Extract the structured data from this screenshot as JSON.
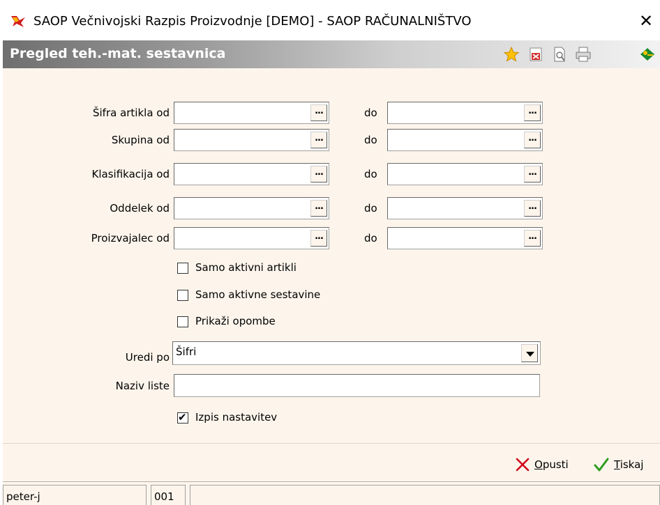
{
  "window": {
    "title": "SAOP   Večnivojski Razpis Proizvodnje [DEMO] - SAOP RAČUNALNIŠTVO",
    "close_symbol": "✕"
  },
  "header": {
    "title": "Pregled teh.-mat. sestavnica",
    "toolbar_icons": [
      "star-icon",
      "excel-export-icon",
      "print-preview-icon",
      "printer-icon",
      "exit-icon"
    ]
  },
  "form": {
    "range_to_label": "do",
    "ellipsis": "...",
    "range_rows": [
      {
        "label": "Šifra artikla od",
        "from_value": "",
        "to_value": ""
      },
      {
        "label": "Skupina od",
        "from_value": "",
        "to_value": ""
      },
      {
        "label": "Klasifikacija od",
        "from_value": "",
        "to_value": ""
      },
      {
        "label": "Oddelek od",
        "from_value": "",
        "to_value": ""
      },
      {
        "label": "Proizvajalec od",
        "from_value": "",
        "to_value": ""
      }
    ],
    "checkboxes": [
      {
        "label": "Samo aktivni artikli",
        "checked": false
      },
      {
        "label": "Samo aktivne sestavine",
        "checked": false
      },
      {
        "label": "Prikaži opombe",
        "checked": false
      }
    ],
    "sort": {
      "label": "Uredi po",
      "value": "Šifri"
    },
    "list_name": {
      "label": "Naziv liste",
      "value": ""
    },
    "print_settings": {
      "label": "Izpis nastavitev",
      "checked": true,
      "mark": "✔"
    }
  },
  "actions": {
    "cancel": {
      "accel": "O",
      "rest": "pusti",
      "icon": "red-x-icon"
    },
    "print": {
      "accel": "T",
      "rest": "iskaj",
      "icon": "green-check-icon"
    }
  },
  "status": {
    "user": "peter-j",
    "code": "001",
    "extra": ""
  },
  "colors": {
    "form_bg": "#fdf5ec",
    "header_gradient_start": "#6f6f6f",
    "header_gradient_end": "#f2f2f2",
    "cancel_red": "#d0021b",
    "confirm_green": "#2e9d1e"
  }
}
